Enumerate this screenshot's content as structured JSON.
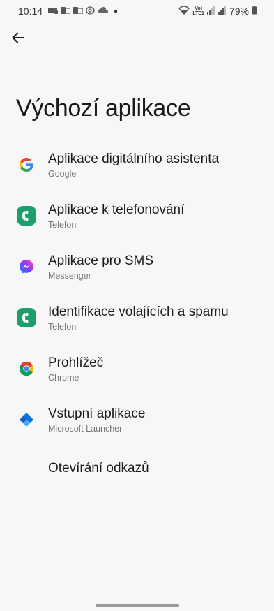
{
  "status_bar": {
    "time": "10:14",
    "battery": "79%",
    "network_label_top": "Vo)",
    "network_label_bottom": "LTE1"
  },
  "header": {
    "title": "Výchozí aplikace"
  },
  "items": [
    {
      "title": "Aplikace digitálního asistenta",
      "subtitle": "Google",
      "icon": "google-icon"
    },
    {
      "title": "Aplikace k telefonování",
      "subtitle": "Telefon",
      "icon": "phone-app-icon"
    },
    {
      "title": "Aplikace pro SMS",
      "subtitle": "Messenger",
      "icon": "messenger-icon"
    },
    {
      "title": "Identifikace volajících a spamu",
      "subtitle": "Telefon",
      "icon": "phone-app-icon"
    },
    {
      "title": "Prohlížeč",
      "subtitle": "Chrome",
      "icon": "chrome-icon"
    },
    {
      "title": "Vstupní aplikace",
      "subtitle": "Microsoft Launcher",
      "icon": "microsoft-launcher-icon"
    },
    {
      "title": "Otevírání odkazů",
      "subtitle": "",
      "icon": ""
    }
  ],
  "colors": {
    "background": "#f7f7f7",
    "phone_green": "#1e9e6a",
    "text_primary": "#1c1c1c",
    "text_secondary": "#777777"
  }
}
